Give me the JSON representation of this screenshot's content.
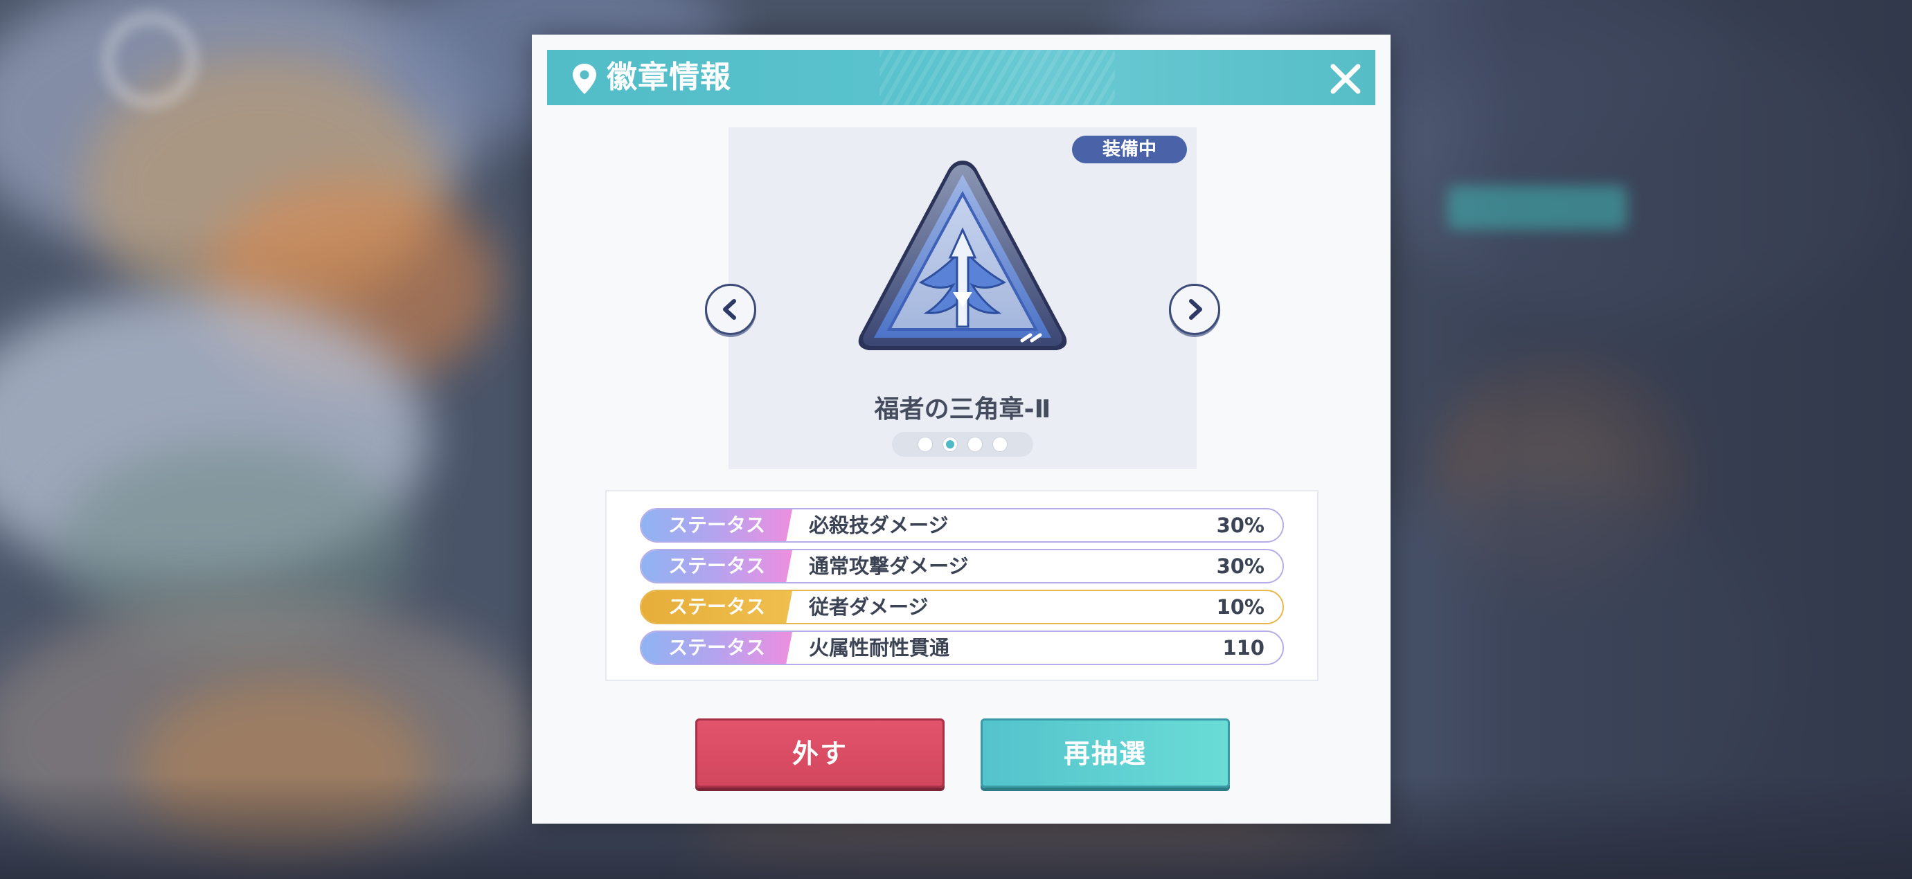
{
  "dialog": {
    "title": "徽章情報",
    "title_icon": "map-pin-icon",
    "close_icon": "close-icon"
  },
  "badge": {
    "status_label": "装備中",
    "name": "福者の三角章-Ⅱ",
    "emblem_icon": "winged-triangle-emblem-icon",
    "page_count": 4,
    "current_page": 2
  },
  "navigation": {
    "prev_icon": "chevron-left-icon",
    "next_icon": "chevron-right-icon"
  },
  "stats": [
    {
      "tag": "ステータス",
      "name": "必殺技ダメージ",
      "value": "30%",
      "tier": "purple"
    },
    {
      "tag": "ステータス",
      "name": "通常攻撃ダメージ",
      "value": "30%",
      "tier": "purple"
    },
    {
      "tag": "ステータス",
      "name": "従者ダメージ",
      "value": "10%",
      "tier": "gold"
    },
    {
      "tag": "ステータス",
      "name": "火属性耐性貫通",
      "value": "110",
      "tier": "purple"
    }
  ],
  "buttons": {
    "remove_label": "外す",
    "reroll_label": "再抽選"
  },
  "colors": {
    "title_bar": "#56bdc7",
    "equipped_pill": "#4a63a8",
    "remove_button": "#d94c64",
    "reroll_button": "#5fcfd1",
    "stat_purple_border": "#b6ace8",
    "stat_gold_border": "#e8b64a"
  }
}
